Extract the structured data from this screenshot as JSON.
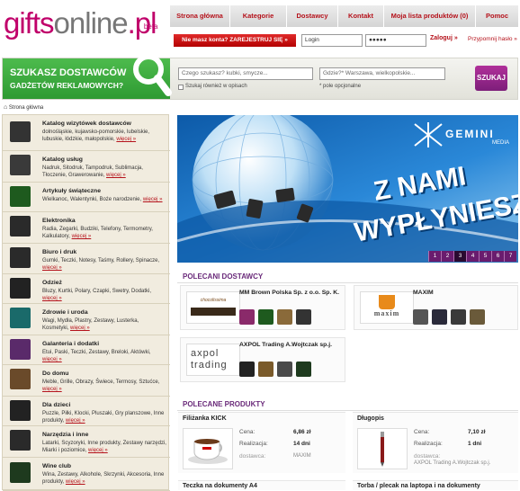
{
  "logo": {
    "gifts": "gifts",
    "online": "online",
    "pl": ".pl",
    "beta": "beta"
  },
  "nav": [
    "Strona główna",
    "Kategorie",
    "Dostawcy",
    "Kontakt",
    "Moja lista produktów (0)",
    "Pomoc"
  ],
  "login": {
    "register_text": "Nie masz konta? ZAREJESTRUJ SIĘ »",
    "login_value": "Login",
    "password_value": "●●●●●",
    "login_button": "Zaloguj »",
    "forgot": "Przypomnij hasło »"
  },
  "search": {
    "line1": "SZUKASZ DOSTAWCÓW",
    "line2": "GADŻETÓW REKLAMOWYCH?",
    "query_placeholder": "Czego szukasz? kubki, smycze...",
    "where_placeholder": "Gdzie?* Warszawa, wielkopolskie...",
    "checkbox_label": "Szukaj również w opisach",
    "optional": "* pole opcjonalne",
    "button": "SZUKAJ"
  },
  "breadcrumb": "Strona główna",
  "categories": [
    {
      "title": "Katalog wizytówek dostawców",
      "desc": "dolnośląskie, kujawsko-pomorskie, lubelskie, lubuskie, łódzkie, małopolskie,",
      "more": "więcej »",
      "color": "#333333"
    },
    {
      "title": "Katalog usług",
      "desc": "Nadruk, Sitodruk, Tampodruk, Sublimacja, Tłoczenie, Grawerowanie,",
      "more": "więcej »",
      "color": "#3a3a3a"
    },
    {
      "title": "Artykuły świąteczne",
      "desc": "Wielkanoc, Walentynki, Boże narodzenie,",
      "more": "więcej »",
      "color": "#1e5a1e"
    },
    {
      "title": "Elektronika",
      "desc": "Radia, Zegarki, Budziki, Telefony, Termometry, Kalkulatory,",
      "more": "więcej »",
      "color": "#2a2a2a"
    },
    {
      "title": "Biuro i druk",
      "desc": "Gumki, Teczki, Notesy, Taśmy, Rollery, Spinacze,",
      "more": "więcej »",
      "color": "#2a2a2a"
    },
    {
      "title": "Odzież",
      "desc": "Bluzy, Kurtki, Polary, Czapki, Swetry, Dodatki,",
      "more": "więcej »",
      "color": "#222222"
    },
    {
      "title": "Zdrowie i uroda",
      "desc": "Wagi, Mydła, Plastry, Zestawy, Lusterka, Kosmetyki,",
      "more": "więcej »",
      "color": "#1a6a6a"
    },
    {
      "title": "Galanteria i dodatki",
      "desc": "Etui, Paski, Teczki, Zestawy, Breloki, Aktówki,",
      "more": "więcej »",
      "color": "#5a2a6a"
    },
    {
      "title": "Do domu",
      "desc": "Meble, Grille, Obrazy, Świece, Termosy, Sztućce,",
      "more": "więcej »",
      "color": "#6a4a2a"
    },
    {
      "title": "Dla dzieci",
      "desc": "Puzzle, Piłki, Klocki, Pluszaki, Gry planszowe, Inne produkty,",
      "more": "więcej »",
      "color": "#222222"
    },
    {
      "title": "Narzędzia i inne",
      "desc": "Latarki, Scyzoryki, Inne produkty, Zestawy narzędzi, Miarki i poziomice,",
      "more": "więcej »",
      "color": "#2a2a2a"
    },
    {
      "title": "Wine club",
      "desc": "Wina, Zestawy, Alkohole, Skrzynki, Akcesoria, Inne produkty,",
      "more": "więcej »",
      "color": "#1e3a1e"
    }
  ],
  "banner": {
    "brand": "GEMINI",
    "sub": "MEDIA",
    "line1": "Z NAMI",
    "line2": "WYPŁYNIESZ",
    "pages": [
      "1",
      "2",
      "3",
      "4",
      "5",
      "6",
      "7"
    ],
    "active_page": "3"
  },
  "suppliers": {
    "title": "POLECANI DOSTAWCY",
    "items": [
      {
        "name": "MM Brown Polska Sp. z o.o. Sp. K.",
        "logo_text": "chocolissima"
      },
      {
        "name": "MAXIM",
        "logo_text": "maxim"
      },
      {
        "name": "AXPOL Trading A.Wojtczak sp.j.",
        "logo_text": "axpol trading"
      }
    ]
  },
  "products": {
    "title": "POLECANE PRODUKTY",
    "items": [
      {
        "name": "Filiżanka KICK",
        "price_label": "Cena:",
        "price": "6,86 zł",
        "time_label": "Realizacja:",
        "time": "14 dni",
        "supplier_label": "dostawca:",
        "supplier": "MAXIM"
      },
      {
        "name": "Długopis",
        "price_label": "Cena:",
        "price": "7,10 zł",
        "time_label": "Realizacja:",
        "time": "1 dni",
        "supplier_label": "dostawca:",
        "supplier": "AXPOL Trading A.Wojtczak sp.j."
      },
      {
        "name": "Teczka na dokumenty A4"
      },
      {
        "name": "Torba / plecak na laptopa i na dokumenty"
      }
    ]
  }
}
